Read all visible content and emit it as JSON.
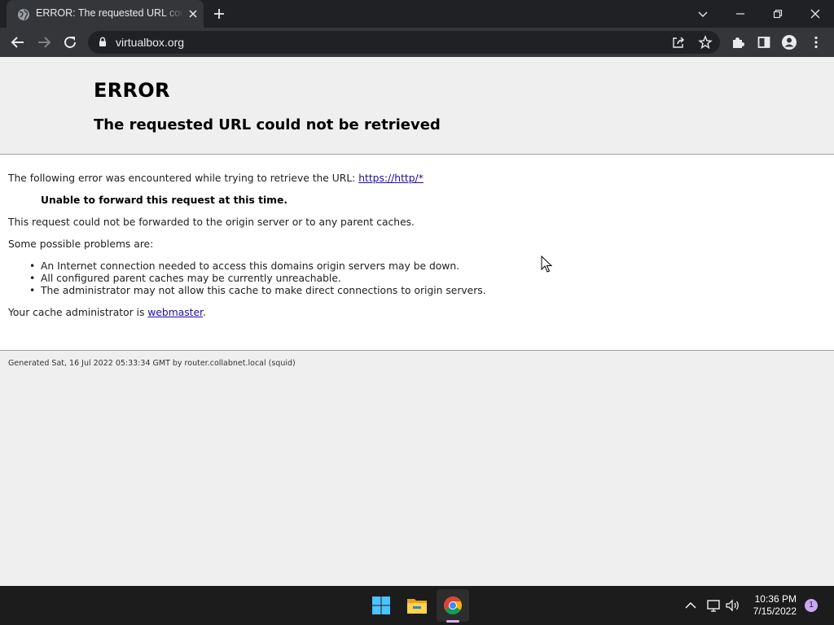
{
  "browser": {
    "tab_title": "ERROR: The requested URL could not be retrieved",
    "url": "virtualbox.org"
  },
  "page": {
    "heading": "ERROR",
    "subheading": "The requested URL could not be retrieved",
    "intro_text": "The following error was encountered while trying to retrieve the URL: ",
    "intro_link": "https://http/*",
    "error_message": "Unable to forward this request at this time.",
    "forward_text": "This request could not be forwarded to the origin server or to any parent caches.",
    "problems_intro": "Some possible problems are:",
    "problems": [
      "An Internet connection needed to access this domains origin servers may be down.",
      "All configured parent caches may be currently unreachable.",
      "The administrator may not allow this cache to make direct connections to origin servers."
    ],
    "admin_text": "Your cache administrator is ",
    "admin_link": "webmaster",
    "admin_suffix": ".",
    "footer": "Generated Sat, 16 Jul 2022 05:33:34 GMT by router.collabnet.local (squid)"
  },
  "taskbar": {
    "time": "10:36 PM",
    "date": "7/15/2022",
    "notification_count": "1",
    "apps": [
      "windows-start-icon",
      "file-explorer-icon",
      "chrome-icon"
    ]
  },
  "colors": {
    "chrome_dark": "#202124",
    "toolbar": "#35363a",
    "page_bg": "#efefef",
    "content_bg": "#ffffff",
    "link": "#1a0dab",
    "taskbar_bg": "#1c1c1c"
  }
}
